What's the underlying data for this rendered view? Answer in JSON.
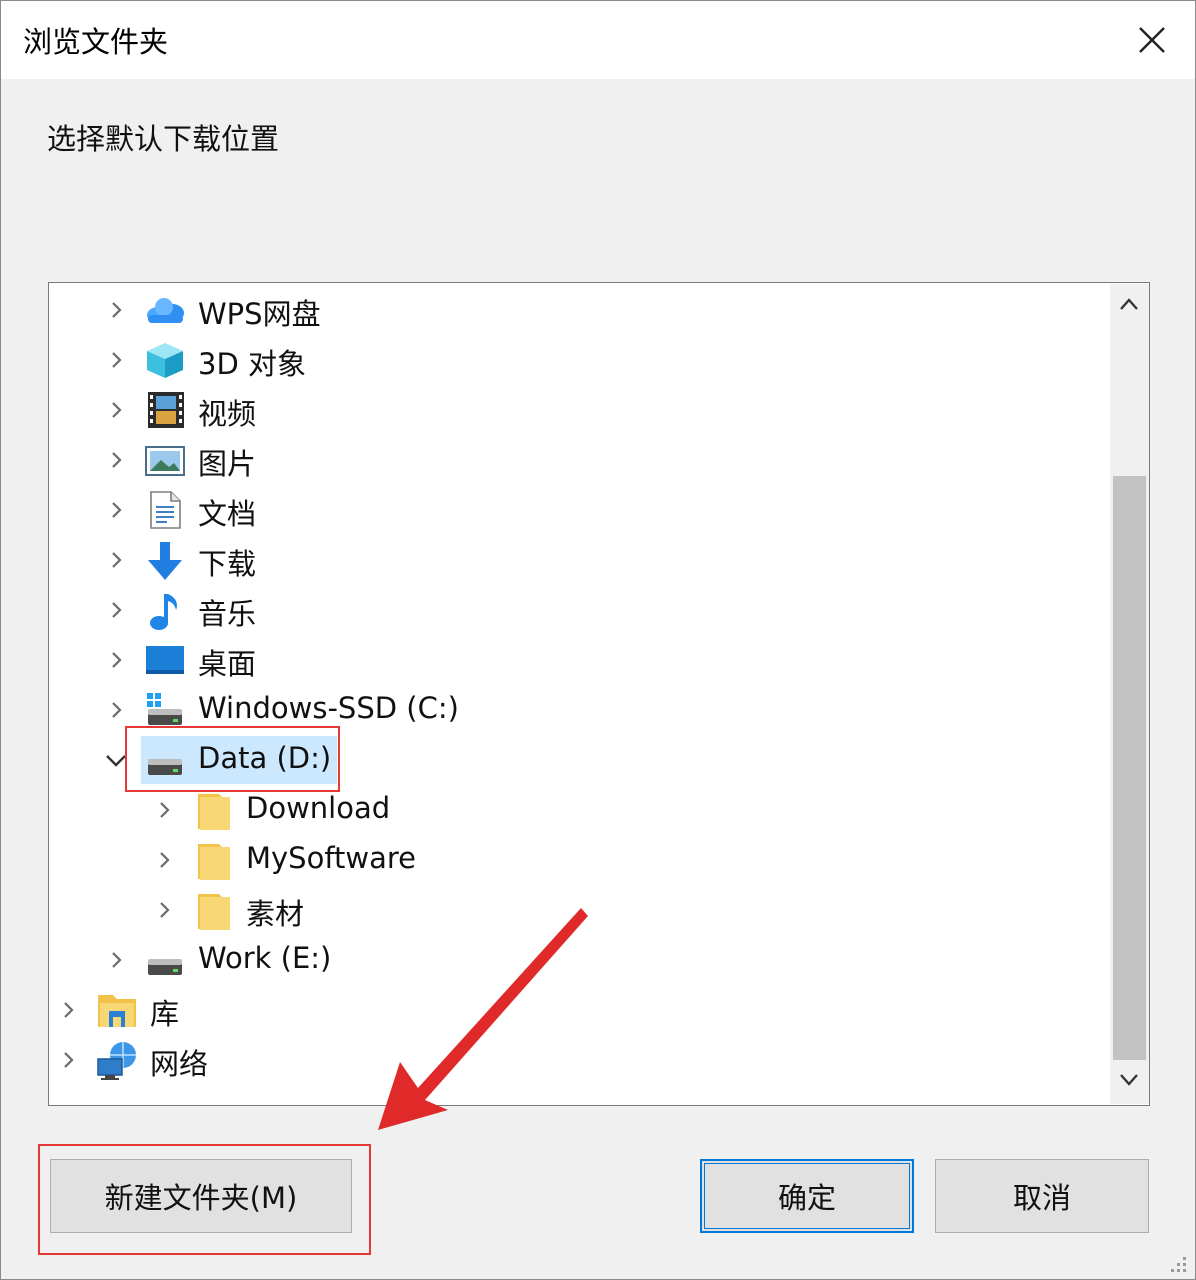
{
  "window": {
    "title": "浏览文件夹"
  },
  "prompt": "选择默认下载位置",
  "tree": {
    "items": [
      {
        "label": "WPS网盘",
        "icon": "cloud-icon",
        "state": "collapsed"
      },
      {
        "label": "3D 对象",
        "icon": "3d-objects-icon",
        "state": "collapsed"
      },
      {
        "label": "视频",
        "icon": "video-icon",
        "state": "collapsed"
      },
      {
        "label": "图片",
        "icon": "pictures-icon",
        "state": "collapsed"
      },
      {
        "label": "文档",
        "icon": "documents-icon",
        "state": "collapsed"
      },
      {
        "label": "下载",
        "icon": "download-icon",
        "state": "collapsed"
      },
      {
        "label": "音乐",
        "icon": "music-icon",
        "state": "collapsed"
      },
      {
        "label": "桌面",
        "icon": "desktop-icon",
        "state": "collapsed"
      },
      {
        "label": "Windows-SSD (C:)",
        "icon": "windows-drive-icon",
        "state": "collapsed"
      },
      {
        "label": "Data (D:)",
        "icon": "drive-icon",
        "state": "expanded",
        "selected": true
      },
      {
        "label": "Download",
        "icon": "folder-icon",
        "state": "collapsed"
      },
      {
        "label": "MySoftware",
        "icon": "folder-icon",
        "state": "collapsed"
      },
      {
        "label": "素材",
        "icon": "folder-icon",
        "state": "collapsed"
      },
      {
        "label": "Work (E:)",
        "icon": "drive-icon",
        "state": "collapsed"
      },
      {
        "label": "库",
        "icon": "library-icon",
        "state": "collapsed"
      },
      {
        "label": "网络",
        "icon": "network-icon",
        "state": "collapsed"
      }
    ]
  },
  "buttons": {
    "new_folder": "新建文件夹(M)",
    "ok": "确定",
    "cancel": "取消"
  },
  "colors": {
    "selection": "#cce8ff",
    "accent": "#0078d7",
    "annotation": "#e53935",
    "folder": "#f8d775"
  }
}
